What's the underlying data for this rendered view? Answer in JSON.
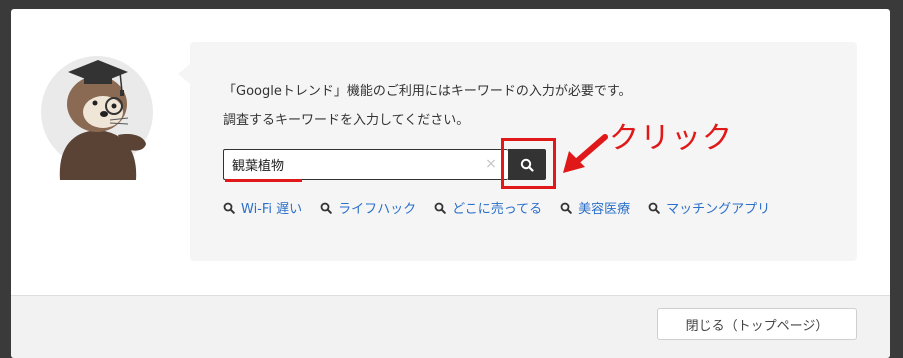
{
  "message": {
    "line1": "「Googleトレンド」機能のご利用にはキーワードの入力が必要です。",
    "line2": "調査するキーワードを入力してください。"
  },
  "search": {
    "value": "観葉植物",
    "clear_icon": "×"
  },
  "suggestions": [
    {
      "label": "Wi-Fi 遅い"
    },
    {
      "label": "ライフハック"
    },
    {
      "label": "どこに売ってる"
    },
    {
      "label": "美容医療"
    },
    {
      "label": "マッチングアプリ"
    }
  ],
  "footer": {
    "close_label": "閉じる（トップページ）"
  },
  "annotation": {
    "label": "クリック",
    "color": "#e01818"
  },
  "icons": {
    "search": "search-icon",
    "mascot": "sea-otter-graduate-mascot"
  }
}
